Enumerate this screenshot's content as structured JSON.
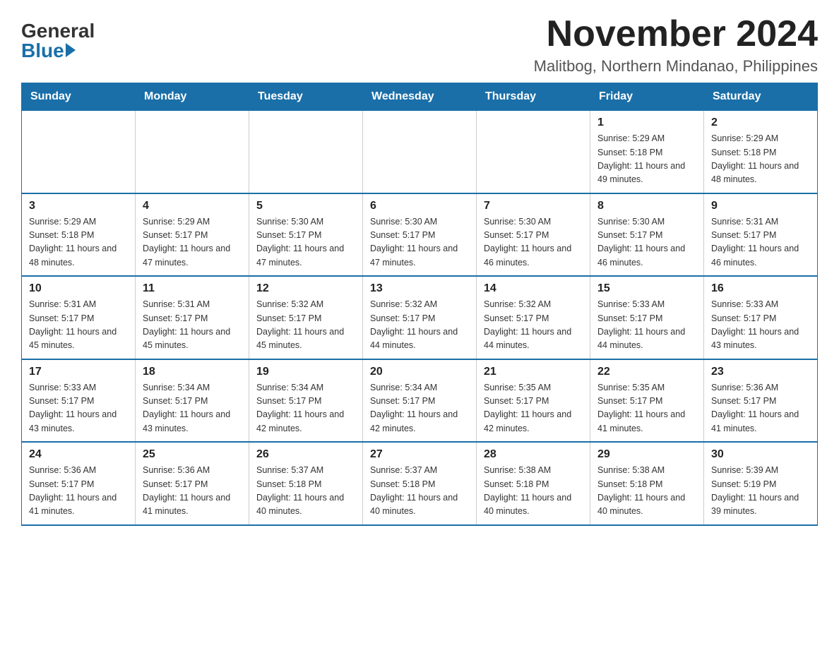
{
  "logo": {
    "general": "General",
    "blue": "Blue"
  },
  "header": {
    "month_year": "November 2024",
    "location": "Malitbog, Northern Mindanao, Philippines"
  },
  "days_of_week": [
    "Sunday",
    "Monday",
    "Tuesday",
    "Wednesday",
    "Thursday",
    "Friday",
    "Saturday"
  ],
  "weeks": [
    [
      {
        "day": "",
        "info": ""
      },
      {
        "day": "",
        "info": ""
      },
      {
        "day": "",
        "info": ""
      },
      {
        "day": "",
        "info": ""
      },
      {
        "day": "",
        "info": ""
      },
      {
        "day": "1",
        "info": "Sunrise: 5:29 AM\nSunset: 5:18 PM\nDaylight: 11 hours and 49 minutes."
      },
      {
        "day": "2",
        "info": "Sunrise: 5:29 AM\nSunset: 5:18 PM\nDaylight: 11 hours and 48 minutes."
      }
    ],
    [
      {
        "day": "3",
        "info": "Sunrise: 5:29 AM\nSunset: 5:18 PM\nDaylight: 11 hours and 48 minutes."
      },
      {
        "day": "4",
        "info": "Sunrise: 5:29 AM\nSunset: 5:17 PM\nDaylight: 11 hours and 47 minutes."
      },
      {
        "day": "5",
        "info": "Sunrise: 5:30 AM\nSunset: 5:17 PM\nDaylight: 11 hours and 47 minutes."
      },
      {
        "day": "6",
        "info": "Sunrise: 5:30 AM\nSunset: 5:17 PM\nDaylight: 11 hours and 47 minutes."
      },
      {
        "day": "7",
        "info": "Sunrise: 5:30 AM\nSunset: 5:17 PM\nDaylight: 11 hours and 46 minutes."
      },
      {
        "day": "8",
        "info": "Sunrise: 5:30 AM\nSunset: 5:17 PM\nDaylight: 11 hours and 46 minutes."
      },
      {
        "day": "9",
        "info": "Sunrise: 5:31 AM\nSunset: 5:17 PM\nDaylight: 11 hours and 46 minutes."
      }
    ],
    [
      {
        "day": "10",
        "info": "Sunrise: 5:31 AM\nSunset: 5:17 PM\nDaylight: 11 hours and 45 minutes."
      },
      {
        "day": "11",
        "info": "Sunrise: 5:31 AM\nSunset: 5:17 PM\nDaylight: 11 hours and 45 minutes."
      },
      {
        "day": "12",
        "info": "Sunrise: 5:32 AM\nSunset: 5:17 PM\nDaylight: 11 hours and 45 minutes."
      },
      {
        "day": "13",
        "info": "Sunrise: 5:32 AM\nSunset: 5:17 PM\nDaylight: 11 hours and 44 minutes."
      },
      {
        "day": "14",
        "info": "Sunrise: 5:32 AM\nSunset: 5:17 PM\nDaylight: 11 hours and 44 minutes."
      },
      {
        "day": "15",
        "info": "Sunrise: 5:33 AM\nSunset: 5:17 PM\nDaylight: 11 hours and 44 minutes."
      },
      {
        "day": "16",
        "info": "Sunrise: 5:33 AM\nSunset: 5:17 PM\nDaylight: 11 hours and 43 minutes."
      }
    ],
    [
      {
        "day": "17",
        "info": "Sunrise: 5:33 AM\nSunset: 5:17 PM\nDaylight: 11 hours and 43 minutes."
      },
      {
        "day": "18",
        "info": "Sunrise: 5:34 AM\nSunset: 5:17 PM\nDaylight: 11 hours and 43 minutes."
      },
      {
        "day": "19",
        "info": "Sunrise: 5:34 AM\nSunset: 5:17 PM\nDaylight: 11 hours and 42 minutes."
      },
      {
        "day": "20",
        "info": "Sunrise: 5:34 AM\nSunset: 5:17 PM\nDaylight: 11 hours and 42 minutes."
      },
      {
        "day": "21",
        "info": "Sunrise: 5:35 AM\nSunset: 5:17 PM\nDaylight: 11 hours and 42 minutes."
      },
      {
        "day": "22",
        "info": "Sunrise: 5:35 AM\nSunset: 5:17 PM\nDaylight: 11 hours and 41 minutes."
      },
      {
        "day": "23",
        "info": "Sunrise: 5:36 AM\nSunset: 5:17 PM\nDaylight: 11 hours and 41 minutes."
      }
    ],
    [
      {
        "day": "24",
        "info": "Sunrise: 5:36 AM\nSunset: 5:17 PM\nDaylight: 11 hours and 41 minutes."
      },
      {
        "day": "25",
        "info": "Sunrise: 5:36 AM\nSunset: 5:17 PM\nDaylight: 11 hours and 41 minutes."
      },
      {
        "day": "26",
        "info": "Sunrise: 5:37 AM\nSunset: 5:18 PM\nDaylight: 11 hours and 40 minutes."
      },
      {
        "day": "27",
        "info": "Sunrise: 5:37 AM\nSunset: 5:18 PM\nDaylight: 11 hours and 40 minutes."
      },
      {
        "day": "28",
        "info": "Sunrise: 5:38 AM\nSunset: 5:18 PM\nDaylight: 11 hours and 40 minutes."
      },
      {
        "day": "29",
        "info": "Sunrise: 5:38 AM\nSunset: 5:18 PM\nDaylight: 11 hours and 40 minutes."
      },
      {
        "day": "30",
        "info": "Sunrise: 5:39 AM\nSunset: 5:19 PM\nDaylight: 11 hours and 39 minutes."
      }
    ]
  ]
}
